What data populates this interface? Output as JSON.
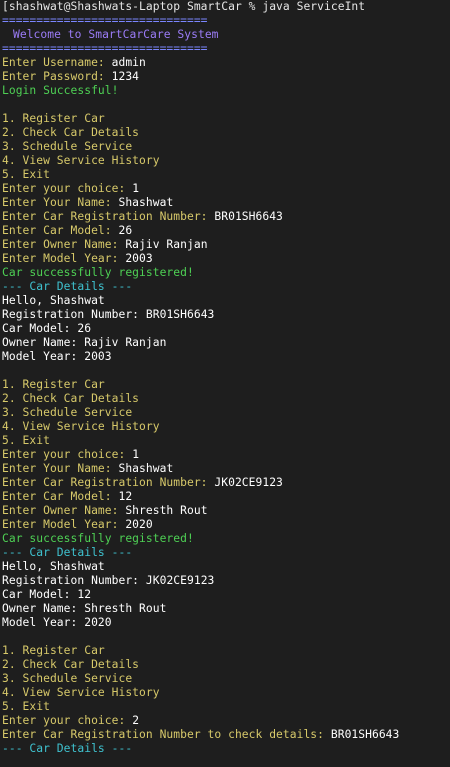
{
  "colors": {
    "background": "#1e1e1e",
    "text": "#ffffff",
    "prompt_yellow": "#d7c96a",
    "banner_purple": "#9b7cf7",
    "success_green": "#4ed054",
    "details_cyan": "#3fc2cf",
    "separator_blue": "#7b86ff"
  },
  "terminal": {
    "command_line": "[shashwat@Shashwats-Laptop SmartCar % java ServiceInt",
    "separator": "==============================",
    "banner": "Welcome to SmartCarCare System",
    "login": {
      "username_label": "Enter Username: ",
      "username_value": "admin",
      "password_label": "Enter Password: ",
      "password_value": "1234",
      "success": "Login Successful!"
    },
    "menu": [
      "1. Register Car",
      "2. Check Car Details",
      "3. Schedule Service",
      "4. View Service History",
      "5. Exit"
    ],
    "labels": {
      "choice": "Enter your choice: ",
      "your_name": "Enter Your Name: ",
      "reg_number": "Enter Car Registration Number: ",
      "car_model": "Enter Car Model: ",
      "owner_name": "Enter Owner Name: ",
      "model_year": "Enter Model Year: ",
      "registered": "Car successfully registered!",
      "details_header": "--- Car Details ---",
      "hello": "Hello, ",
      "d_reg": "Registration Number: ",
      "d_model": "Car Model: ",
      "d_owner": "Owner Name: ",
      "d_year": "Model Year: ",
      "check_prompt": "Enter Car Registration Number to check details: "
    },
    "session1": {
      "choice": "1",
      "name": "Shashwat",
      "reg": "BR01SH6643",
      "model": "26",
      "owner": "Rajiv Ranjan",
      "year": "2003"
    },
    "session2": {
      "choice": "1",
      "name": "Shashwat",
      "reg": "JK02CE9123",
      "model": "12",
      "owner": "Shresth Rout",
      "year": "2020"
    },
    "session3": {
      "choice": "2",
      "check_reg": "BR01SH6643"
    }
  }
}
